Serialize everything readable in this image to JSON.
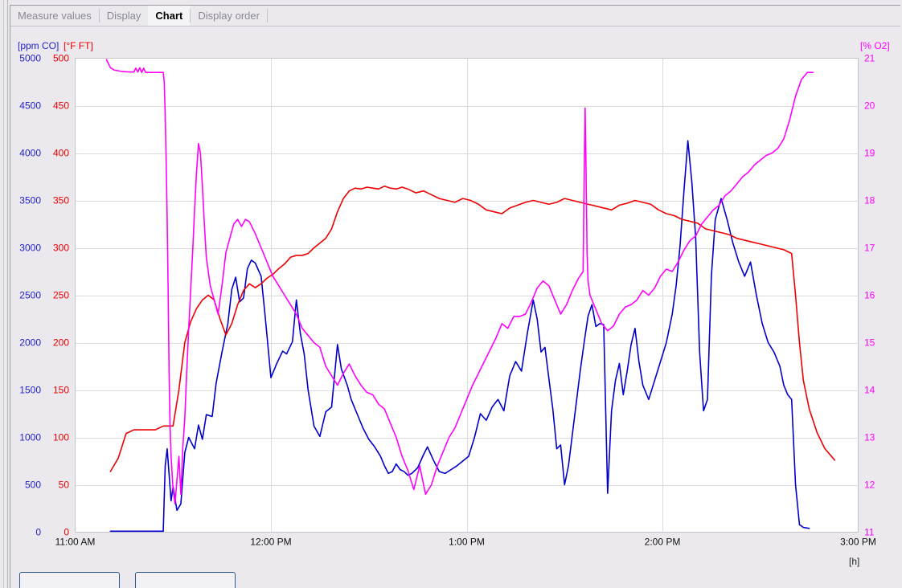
{
  "window": {
    "title": "Chart"
  },
  "tabs": [
    {
      "label": "Measure values",
      "active": false
    },
    {
      "label": "Display",
      "active": false
    },
    {
      "label": "Chart",
      "active": true
    },
    {
      "label": "Display order",
      "active": false
    }
  ],
  "axis_captions": {
    "left_primary": "[ppm CO]",
    "left_secondary": "[°F FT]",
    "right": "[% O2]",
    "x_unit": "[h]"
  },
  "colors": {
    "co_blue": "#0000cc",
    "ft_red": "#ee0000",
    "o2_magenta": "#ff00ff",
    "plot_background": "#ffffff",
    "grid": "#dcdadf",
    "panel_background": "#ebe9ee",
    "tab_active_text": "#000000",
    "tab_inactive_text": "#8b8a90"
  },
  "chart_data": {
    "type": "line",
    "title": "",
    "xlabel": "[h]",
    "grid": true,
    "legend": "none",
    "x_axis": {
      "tick_labels": [
        "11:00 AM",
        "12:00 PM",
        "1:00 PM",
        "2:00 PM",
        "3:00 PM"
      ],
      "tick_values": [
        11.0,
        12.0,
        13.0,
        14.0,
        15.0
      ],
      "xlim": [
        11.0,
        15.0
      ]
    },
    "y_axes": [
      {
        "name": "CO",
        "unit": "[ppm CO]",
        "color": "#2222cc",
        "ylim": [
          0,
          5000
        ],
        "tick_labels": [
          "5000",
          "4500",
          "4000",
          "3500",
          "3000",
          "2500",
          "2000",
          "1500",
          "1000",
          "500",
          "0"
        ],
        "tick_values": [
          5000,
          4500,
          4000,
          3500,
          3000,
          2500,
          2000,
          1500,
          1000,
          500,
          0
        ]
      },
      {
        "name": "FT",
        "unit": "[°F FT]",
        "color": "#ee0000",
        "ylim": [
          0,
          500
        ],
        "tick_labels": [
          "500",
          "450",
          "400",
          "350",
          "300",
          "250",
          "200",
          "150",
          "100",
          "50",
          "0"
        ],
        "tick_values": [
          500,
          450,
          400,
          350,
          300,
          250,
          200,
          150,
          100,
          50,
          0
        ]
      },
      {
        "name": "O2",
        "unit": "[% O2]",
        "color": "#ff00ff",
        "ylim": [
          11,
          21
        ],
        "tick_labels": [
          "21",
          "20",
          "19",
          "18",
          "17",
          "16",
          "15",
          "14",
          "13",
          "12",
          "11"
        ],
        "tick_values": [
          21,
          20,
          19,
          18,
          17,
          16,
          15,
          14,
          13,
          12,
          11
        ]
      }
    ],
    "series": [
      {
        "name": "CO",
        "axis": "CO",
        "unit": "ppm",
        "color": "#0000cc",
        "x": [
          11.18,
          11.26,
          11.45,
          11.46,
          11.47,
          11.49,
          11.5,
          11.52,
          11.54,
          11.56,
          11.58,
          11.61,
          11.63,
          11.65,
          11.67,
          11.7,
          11.72,
          11.75,
          11.78,
          11.8,
          11.82,
          11.84,
          11.86,
          11.88,
          11.9,
          11.92,
          11.95,
          11.97,
          12.0,
          12.03,
          12.06,
          12.08,
          12.11,
          12.13,
          12.15,
          12.17,
          12.19,
          12.22,
          12.25,
          12.28,
          12.31,
          12.34,
          12.36,
          12.39,
          12.41,
          12.44,
          12.47,
          12.5,
          12.53,
          12.56,
          12.58,
          12.6,
          12.62,
          12.64,
          12.66,
          12.68,
          12.7,
          12.72,
          12.75,
          12.78,
          12.8,
          12.83,
          12.86,
          12.89,
          12.92,
          12.95,
          12.98,
          13.01,
          13.04,
          13.07,
          13.1,
          13.13,
          13.16,
          13.19,
          13.22,
          13.25,
          13.28,
          13.31,
          13.34,
          13.36,
          13.38,
          13.4,
          13.42,
          13.44,
          13.46,
          13.48,
          13.5,
          13.52,
          13.55,
          13.58,
          13.6,
          13.62,
          13.64,
          13.66,
          13.68,
          13.7,
          13.72,
          13.74,
          13.76,
          13.78,
          13.8,
          13.82,
          13.84,
          13.86,
          13.88,
          13.9,
          13.93,
          13.96,
          13.99,
          14.02,
          14.05,
          14.07,
          14.09,
          14.11,
          14.13,
          14.15,
          14.17,
          14.19,
          14.21,
          14.23,
          14.25,
          14.27,
          14.3,
          14.33,
          14.36,
          14.39,
          14.42,
          14.45,
          14.48,
          14.51,
          14.54,
          14.57,
          14.6,
          14.62,
          14.64,
          14.66,
          14.68,
          14.7,
          14.72,
          14.75,
          14.8,
          14.85,
          14.9
        ],
        "y": [
          10,
          10,
          10,
          700,
          880,
          330,
          480,
          230,
          300,
          840,
          1000,
          880,
          1130,
          980,
          1240,
          1220,
          1570,
          1900,
          2200,
          2560,
          2690,
          2430,
          2470,
          2780,
          2870,
          2840,
          2700,
          2290,
          1630,
          1780,
          1910,
          1880,
          2010,
          2450,
          2100,
          1880,
          1500,
          1120,
          1010,
          1270,
          1320,
          1980,
          1720,
          1550,
          1400,
          1250,
          1100,
          980,
          900,
          800,
          700,
          620,
          640,
          720,
          660,
          640,
          600,
          620,
          680,
          820,
          900,
          760,
          640,
          620,
          660,
          700,
          750,
          800,
          1000,
          1250,
          1180,
          1320,
          1400,
          1280,
          1650,
          1800,
          1700,
          2100,
          2450,
          2250,
          1900,
          1950,
          1620,
          1300,
          880,
          920,
          500,
          700,
          1200,
          1700,
          2000,
          2280,
          2400,
          2170,
          2200,
          2190,
          410,
          1280,
          1600,
          1780,
          1450,
          1700,
          1980,
          2150,
          1800,
          1550,
          1400,
          1600,
          1800,
          2000,
          2300,
          2600,
          3020,
          3600,
          4130,
          3700,
          3100,
          1900,
          1280,
          1400,
          2700,
          3300,
          3520,
          3300,
          3050,
          2850,
          2700,
          2850,
          2500,
          2200,
          2000,
          1900,
          1750,
          1550,
          1450,
          1400,
          500,
          80,
          50,
          40
        ]
      },
      {
        "name": "FT",
        "axis": "FT",
        "unit": "°F",
        "color": "#ee0000",
        "x": [
          11.18,
          11.22,
          11.26,
          11.3,
          11.34,
          11.38,
          11.41,
          11.43,
          11.45,
          11.46,
          11.48,
          11.5,
          11.53,
          11.56,
          11.59,
          11.62,
          11.65,
          11.68,
          11.71,
          11.74,
          11.77,
          11.8,
          11.83,
          11.86,
          11.89,
          11.92,
          11.95,
          11.98,
          12.01,
          12.04,
          12.07,
          12.1,
          12.13,
          12.16,
          12.19,
          12.22,
          12.25,
          12.28,
          12.31,
          12.34,
          12.37,
          12.4,
          12.43,
          12.46,
          12.49,
          12.52,
          12.55,
          12.58,
          12.61,
          12.64,
          12.67,
          12.7,
          12.74,
          12.78,
          12.82,
          12.86,
          12.9,
          12.94,
          12.98,
          13.02,
          13.06,
          13.1,
          13.14,
          13.18,
          13.22,
          13.26,
          13.3,
          13.34,
          13.38,
          13.42,
          13.46,
          13.5,
          13.54,
          13.58,
          13.62,
          13.66,
          13.7,
          13.74,
          13.78,
          13.82,
          13.86,
          13.9,
          13.94,
          13.98,
          14.02,
          14.06,
          14.1,
          14.14,
          14.18,
          14.22,
          14.26,
          14.3,
          14.34,
          14.38,
          14.42,
          14.46,
          14.5,
          14.54,
          14.58,
          14.62,
          14.64,
          14.66,
          14.68,
          14.7,
          14.72,
          14.75,
          14.79,
          14.83,
          14.88
        ],
        "y": [
          64,
          78,
          104,
          108,
          108,
          108,
          108,
          110,
          112,
          112,
          112,
          112,
          150,
          200,
          222,
          236,
          245,
          250,
          245,
          225,
          208,
          220,
          240,
          255,
          262,
          258,
          262,
          268,
          272,
          278,
          283,
          290,
          292,
          292,
          294,
          300,
          305,
          310,
          320,
          338,
          352,
          360,
          363,
          362,
          364,
          363,
          362,
          365,
          363,
          362,
          364,
          362,
          358,
          360,
          356,
          352,
          350,
          348,
          352,
          350,
          346,
          340,
          338,
          336,
          342,
          345,
          348,
          350,
          348,
          346,
          348,
          352,
          350,
          348,
          346,
          344,
          342,
          340,
          345,
          347,
          350,
          348,
          346,
          340,
          336,
          334,
          330,
          328,
          326,
          320,
          318,
          316,
          314,
          310,
          308,
          306,
          304,
          302,
          300,
          298,
          296,
          294,
          250,
          200,
          160,
          130,
          105,
          88,
          76
        ]
      },
      {
        "name": "O2",
        "axis": "O2",
        "unit": "%",
        "color": "#ff00ff",
        "x": [
          11.16,
          11.18,
          11.2,
          11.24,
          11.28,
          11.3,
          11.31,
          11.32,
          11.33,
          11.34,
          11.35,
          11.36,
          11.38,
          11.42,
          11.45,
          11.455,
          11.46,
          11.465,
          11.47,
          11.475,
          11.48,
          11.485,
          11.49,
          11.5,
          11.51,
          11.52,
          11.53,
          11.54,
          11.55,
          11.56,
          11.57,
          11.58,
          11.59,
          11.6,
          11.61,
          11.62,
          11.63,
          11.64,
          11.65,
          11.66,
          11.67,
          11.69,
          11.71,
          11.73,
          11.75,
          11.77,
          11.79,
          11.81,
          11.83,
          11.85,
          11.87,
          11.89,
          11.92,
          11.95,
          11.98,
          12.01,
          12.04,
          12.07,
          12.1,
          12.13,
          12.16,
          12.19,
          12.22,
          12.25,
          12.28,
          12.31,
          12.34,
          12.37,
          12.4,
          12.43,
          12.46,
          12.49,
          12.52,
          12.55,
          12.58,
          12.61,
          12.64,
          12.67,
          12.7,
          12.73,
          12.76,
          12.79,
          12.82,
          12.85,
          12.88,
          12.91,
          12.94,
          12.97,
          13.0,
          13.03,
          13.06,
          13.09,
          13.12,
          13.15,
          13.18,
          13.21,
          13.24,
          13.27,
          13.3,
          13.33,
          13.36,
          13.39,
          13.42,
          13.45,
          13.48,
          13.51,
          13.54,
          13.57,
          13.595,
          13.6,
          13.605,
          13.61,
          13.615,
          13.62,
          13.63,
          13.66,
          13.69,
          13.72,
          13.75,
          13.78,
          13.81,
          13.84,
          13.87,
          13.9,
          13.93,
          13.96,
          13.99,
          14.02,
          14.05,
          14.08,
          14.11,
          14.14,
          14.17,
          14.2,
          14.23,
          14.26,
          14.29,
          14.32,
          14.35,
          14.38,
          14.41,
          14.44,
          14.47,
          14.5,
          14.53,
          14.56,
          14.59,
          14.62,
          14.65,
          14.68,
          14.71,
          14.74,
          14.77,
          14.8,
          14.85,
          14.9
        ],
        "y": [
          20.97,
          20.8,
          20.75,
          20.72,
          20.71,
          20.71,
          20.79,
          20.71,
          20.8,
          20.7,
          20.79,
          20.7,
          20.7,
          20.7,
          20.7,
          20.5,
          19.8,
          18.8,
          17.6,
          16.1,
          14.3,
          13.2,
          12.6,
          11.9,
          11.6,
          12.1,
          12.6,
          11.8,
          12.8,
          13.4,
          14.4,
          15.3,
          16.1,
          16.9,
          17.8,
          18.6,
          19.2,
          19.0,
          18.3,
          17.5,
          16.8,
          16.2,
          15.9,
          15.6,
          16.2,
          16.9,
          17.2,
          17.5,
          17.6,
          17.45,
          17.6,
          17.55,
          17.3,
          17.0,
          16.7,
          16.4,
          16.2,
          16.0,
          15.8,
          15.6,
          15.3,
          15.15,
          15.0,
          14.9,
          14.5,
          14.3,
          14.1,
          14.35,
          14.55,
          14.3,
          14.1,
          13.95,
          13.9,
          13.7,
          13.6,
          13.3,
          13.0,
          12.6,
          12.3,
          11.9,
          12.4,
          11.8,
          12.0,
          12.4,
          12.7,
          13.0,
          13.2,
          13.5,
          13.8,
          14.1,
          14.35,
          14.6,
          14.85,
          15.1,
          15.4,
          15.3,
          15.55,
          15.55,
          15.6,
          15.85,
          16.15,
          16.3,
          16.2,
          15.9,
          15.6,
          15.8,
          16.1,
          16.35,
          16.5,
          18.5,
          19.95,
          18.6,
          16.9,
          16.3,
          16.0,
          15.7,
          15.4,
          15.25,
          15.35,
          15.6,
          15.75,
          15.8,
          15.9,
          16.1,
          16.0,
          16.15,
          16.4,
          16.55,
          16.5,
          16.7,
          16.95,
          17.15,
          17.25,
          17.5,
          17.65,
          17.8,
          17.9,
          18.1,
          18.2,
          18.35,
          18.5,
          18.6,
          18.75,
          18.85,
          18.95,
          19.0,
          19.1,
          19.3,
          19.7,
          20.2,
          20.55,
          20.7,
          20.7
        ]
      }
    ]
  },
  "bottom_buttons": [
    {
      "name": "left-button"
    },
    {
      "name": "right-button"
    }
  ]
}
